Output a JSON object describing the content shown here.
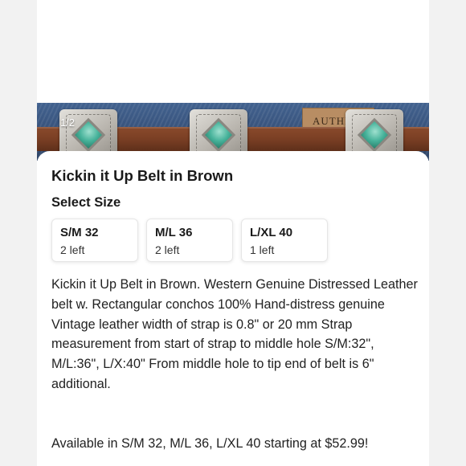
{
  "gallery": {
    "counter": "1/2",
    "patch_text": "AUTHE"
  },
  "product": {
    "title": "Kickin it Up Belt in Brown",
    "size_heading": "Select Size",
    "sizes": [
      {
        "label": "S/M 32",
        "stock": "2 left"
      },
      {
        "label": "M/L 36",
        "stock": "2 left"
      },
      {
        "label": "L/XL 40",
        "stock": "1 left"
      }
    ],
    "description": "Kickin it Up Belt in Brown. Western Genuine Distressed Leather belt w. Rectangular conchos 100% Hand-distress genuine Vintage leather width of strap is 0.8\" or 20 mm Strap measurement from start of strap to middle hole S/M:32\", M/L:36\", L/X:40\" From middle hole to tip end of belt is 6\" additional.",
    "availability": "Available in S/M 32, M/L 36, L/XL 40 starting at $52.99!"
  },
  "colors": {
    "background": "#f2f2f2",
    "card": "#ffffff",
    "denim": "#3a5680",
    "leather": "#7a3f24",
    "turquoise": "#46b29a"
  }
}
